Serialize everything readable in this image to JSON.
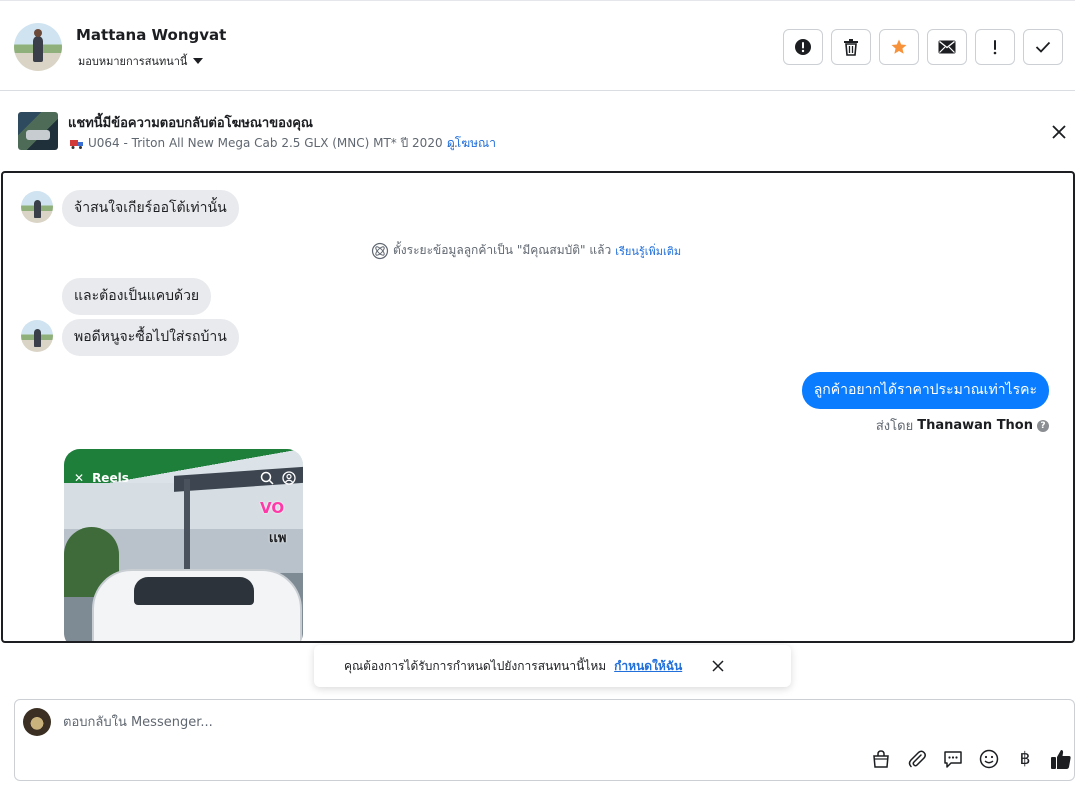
{
  "header": {
    "contact_name": "Mattana Wongvat",
    "assign_label": "มอบหมายการสนทนานี้",
    "actions": [
      {
        "name": "spam-button",
        "icon": "alert-circle-icon"
      },
      {
        "name": "delete-button",
        "icon": "trash-icon"
      },
      {
        "name": "star-button",
        "icon": "star-icon"
      },
      {
        "name": "mark-unread-button",
        "icon": "mail-icon"
      },
      {
        "name": "follow-up-button",
        "icon": "exclamation-icon"
      },
      {
        "name": "mark-done-button",
        "icon": "check-icon"
      }
    ],
    "star_color": "#f7923b"
  },
  "ad_banner": {
    "title": "แชทนี้มีข้อความตอบกลับต่อโฆษณาของคุณ",
    "subtitle": "U064 - Triton All New Mega Cab 2.5 GLX (MNC) MT* ปี 2020 ...",
    "link": "ดูโฆษณา"
  },
  "messages": {
    "m1": "จ้าสนใจเกียร์ออโต้เท่านั้น",
    "system_note": "ตั้งระยะข้อมูลลูกค้าเป็น \"มีคุณสมบัติ\" แล้ว",
    "system_link": "เรียนรู้เพิ่มเติม",
    "m2": "และต้องเป็นแคบด้วย",
    "m3": "พอดีหนูจะซื้อไปใส่รถบ้าน",
    "m4": "ลูกค้าอยากได้ราคาประมาณเท่าไรคะ",
    "sent_by_prefix": "ส่งโดย",
    "sent_by_name": "Thanawan Thon",
    "reel_label": "Reels",
    "reel_sticker_1": "VO",
    "reel_sticker_2": "เเพ"
  },
  "toast": {
    "text": "คุณต้องการได้รับการกำหนดไปยังการสนทนานี้ไหม",
    "link": "กำหนดให้ฉัน"
  },
  "composer": {
    "placeholder": "ตอบกลับใน Messenger...",
    "currency_symbol": "฿",
    "accent_color": "#0a7cff"
  }
}
